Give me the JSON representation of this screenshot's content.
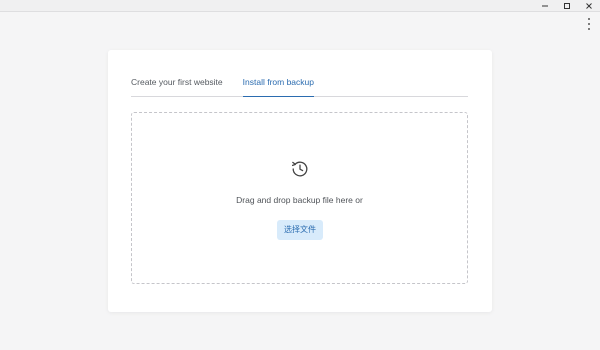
{
  "window": {
    "controls": [
      "minimize",
      "maximize",
      "close"
    ]
  },
  "tabs": [
    {
      "label": "Create your first website",
      "active": false
    },
    {
      "label": "Install from backup",
      "active": true
    }
  ],
  "dropzone": {
    "icon": "history-clock-icon",
    "text": "Drag and drop backup file here or",
    "button_label": "选择文件"
  },
  "colors": {
    "accent": "#2b6cb0",
    "button_bg": "#d8ebfb",
    "page_bg": "#f5f5f6"
  }
}
